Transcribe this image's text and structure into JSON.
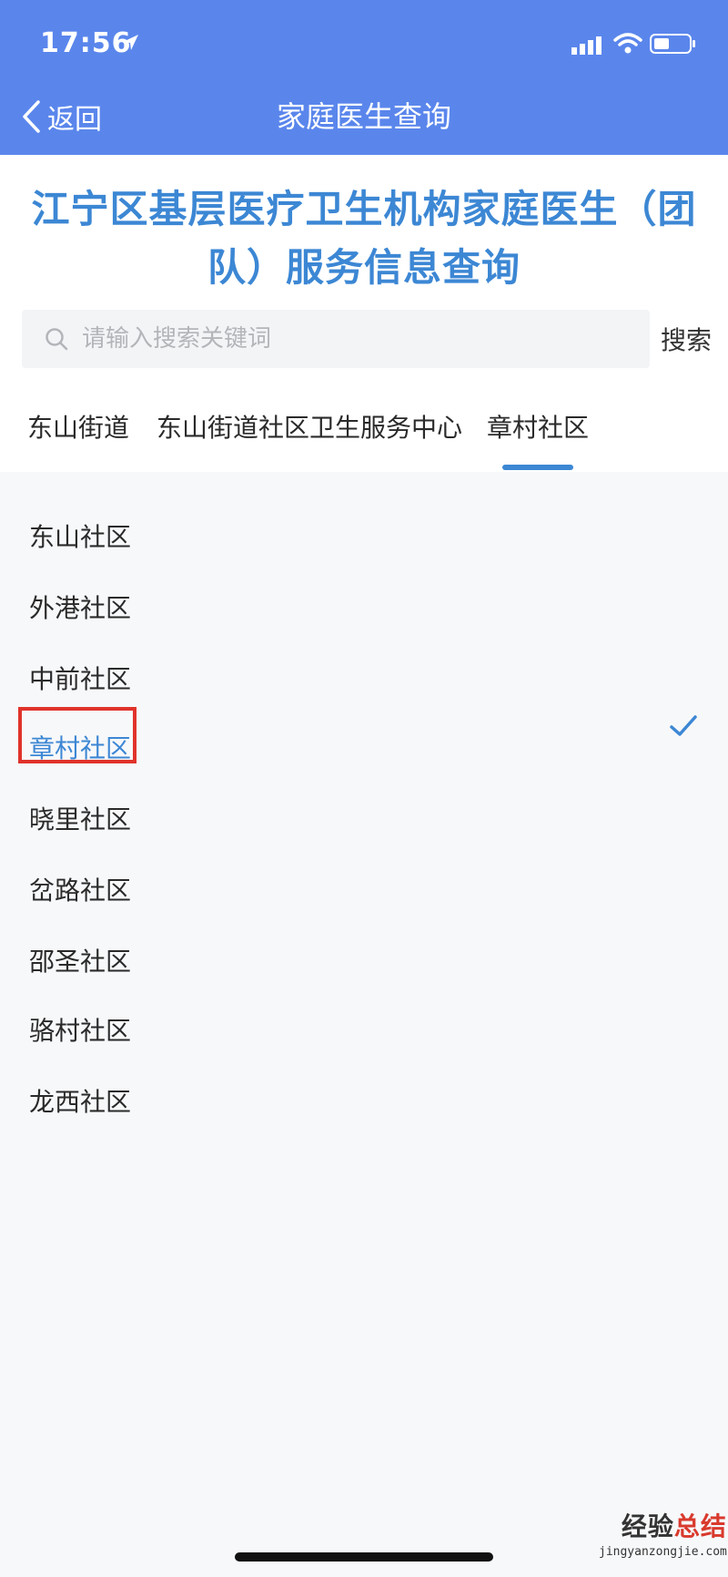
{
  "status_bar": {
    "time": "17:56"
  },
  "nav": {
    "back_label": "返回",
    "title": "家庭医生查询"
  },
  "hero_title": "江宁区基层医疗卫生机构家庭医生（团队）服务信息查询",
  "search": {
    "placeholder": "请输入搜索关键词",
    "value": "",
    "button_label": "搜索"
  },
  "tabs": [
    {
      "label": "东山街道"
    },
    {
      "label": "东山街道社区卫生服务中心"
    },
    {
      "label": "章村社区",
      "active": true
    }
  ],
  "communities": [
    {
      "label": "东山社区"
    },
    {
      "label": "外港社区"
    },
    {
      "label": "中前社区"
    },
    {
      "label": "章村社区",
      "selected": true
    },
    {
      "label": "晓里社区"
    },
    {
      "label": "岔路社区"
    },
    {
      "label": "邵圣社区"
    },
    {
      "label": "骆村社区"
    },
    {
      "label": "龙西社区"
    }
  ],
  "watermark": {
    "title_main": "经验",
    "title_accent": "总结",
    "url": "jingyanzongjie.com"
  },
  "colors": {
    "header_bg": "#5a86ec",
    "accent_blue": "#3c87d4",
    "highlight_red": "#e0332b",
    "page_bg": "#f7f8fa"
  },
  "icons": [
    "location-arrow-icon",
    "signal-icon",
    "wifi-icon",
    "battery-icon",
    "back-chevron-icon",
    "search-icon",
    "checkmark-icon"
  ]
}
